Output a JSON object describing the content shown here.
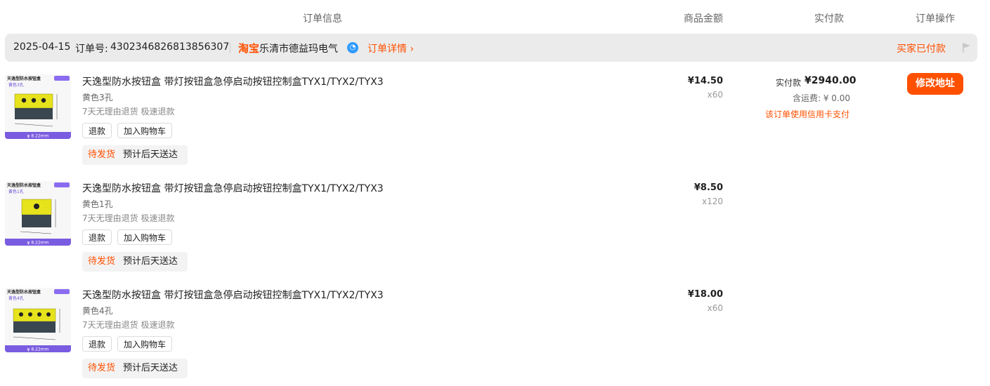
{
  "columns": {
    "order_info": "订单信息",
    "item_amount": "商品金额",
    "paid": "实付款",
    "actions": "订单操作"
  },
  "order": {
    "date": "2025-04-15",
    "number_label": "订单号:",
    "number": "4302346826813856307",
    "platform": "淘宝",
    "shop": "乐清市德益玛电气",
    "detail_link": "订单详情 ›",
    "status": "买家已付款"
  },
  "items": [
    {
      "title": "天逸型防水按钮盒 带灯按钮盒急停启动按钮控制盒TYX1/TYX2/TYX3",
      "spec": "黄色3孔",
      "service": "7天无理由退货 极速退款",
      "refund": "退款",
      "add_cart": "加入购物车",
      "status_a": "待发货",
      "status_b": "预计后天送达",
      "price": "¥14.50",
      "qty": "x60",
      "thumb": {
        "title": "天逸型防水按钮盒",
        "variant": "黄色3孔",
        "holes": 3,
        "bottom": "φ 8.22mm"
      }
    },
    {
      "title": "天逸型防水按钮盒 带灯按钮盒急停启动按钮控制盒TYX1/TYX2/TYX3",
      "spec": "黄色1孔",
      "service": "7天无理由退货 极速退款",
      "refund": "退款",
      "add_cart": "加入购物车",
      "status_a": "待发货",
      "status_b": "预计后天送达",
      "price": "¥8.50",
      "qty": "x120",
      "thumb": {
        "title": "天逸型防水按钮盒",
        "variant": "黄色1孔",
        "holes": 1,
        "bottom": "φ 8.22mm"
      }
    },
    {
      "title": "天逸型防水按钮盒 带灯按钮盒急停启动按钮控制盒TYX1/TYX2/TYX3",
      "spec": "黄色4孔",
      "service": "7天无理由退货 极速退款",
      "refund": "退款",
      "add_cart": "加入购物车",
      "status_a": "待发货",
      "status_b": "预计后天送达",
      "price": "¥18.00",
      "qty": "x60",
      "thumb": {
        "title": "天逸型防水按钮盒",
        "variant": "黄色4孔",
        "holes": 4,
        "bottom": "φ 8.22mm"
      }
    }
  ],
  "payment": {
    "label": "实付款",
    "amount": "¥2940.00",
    "shipping": "含运费: ¥ 0.00",
    "card_note": "该订单使用信用卡支付"
  },
  "actions": {
    "change_address": "修改地址"
  },
  "colors": {
    "accent": "#ff5000",
    "bar_bg": "#ebebeb",
    "wangwang": "#2f9bff"
  }
}
